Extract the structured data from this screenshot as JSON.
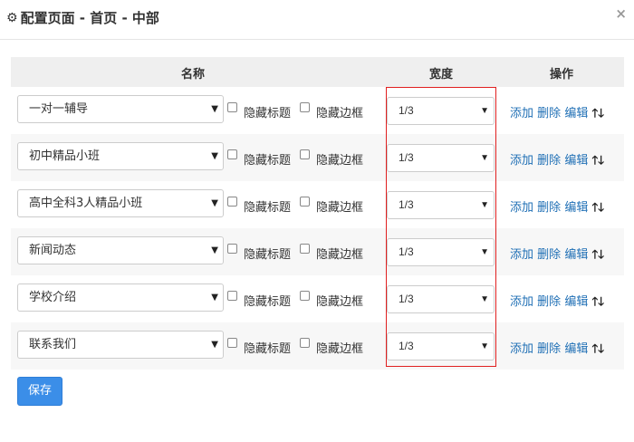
{
  "header": {
    "title": "配置页面 - 首页 - 中部",
    "close_symbol": "×"
  },
  "table": {
    "columns": {
      "name": "名称",
      "width": "宽度",
      "actions": "操作"
    },
    "rows": [
      {
        "name": "一对一辅导",
        "hide_title_label": "隐藏标题",
        "hide_border_label": "隐藏边框",
        "width": "1/3",
        "add": "添加",
        "delete": "删除",
        "edit": "编辑"
      },
      {
        "name": "初中精品小班",
        "hide_title_label": "隐藏标题",
        "hide_border_label": "隐藏边框",
        "width": "1/3",
        "add": "添加",
        "delete": "删除",
        "edit": "编辑"
      },
      {
        "name": "高中全科3人精品小班",
        "hide_title_label": "隐藏标题",
        "hide_border_label": "隐藏边框",
        "width": "1/3",
        "add": "添加",
        "delete": "删除",
        "edit": "编辑"
      },
      {
        "name": "新闻动态",
        "hide_title_label": "隐藏标题",
        "hide_border_label": "隐藏边框",
        "width": "1/3",
        "add": "添加",
        "delete": "删除",
        "edit": "编辑"
      },
      {
        "name": "学校介绍",
        "hide_title_label": "隐藏标题",
        "hide_border_label": "隐藏边框",
        "width": "1/3",
        "add": "添加",
        "delete": "删除",
        "edit": "编辑"
      },
      {
        "name": "联系我们",
        "hide_title_label": "隐藏标题",
        "hide_border_label": "隐藏边框",
        "width": "1/3",
        "add": "添加",
        "delete": "删除",
        "edit": "编辑"
      }
    ]
  },
  "footer": {
    "save_label": "保存"
  },
  "colors": {
    "link": "#1f6fb5",
    "primary_button": "#3b8ee8",
    "highlight": "#e02020"
  },
  "icons": {
    "title_icon": "gear-icon",
    "row_up": "arrow-up-icon",
    "row_down": "arrow-down-icon",
    "select_caret": "caret-down-icon"
  }
}
